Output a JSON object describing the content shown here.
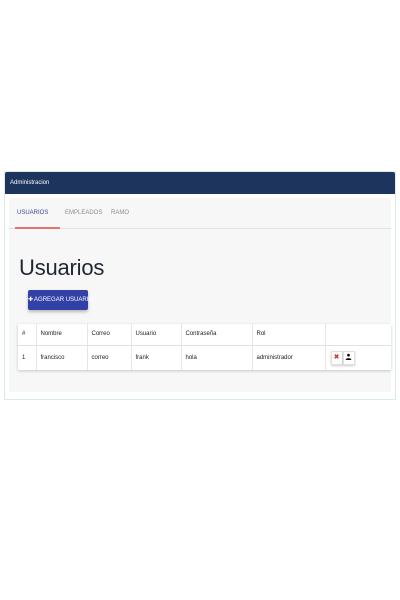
{
  "header": {
    "title": "Administracion"
  },
  "tabs": [
    {
      "label": "USUARIOS",
      "active": true
    },
    {
      "label": "EMPLEADOS",
      "active": false
    },
    {
      "label": "RAMO",
      "active": false
    }
  ],
  "main": {
    "title": "Usuarios",
    "add_button_label": "AGREGAR USUARIO"
  },
  "table": {
    "headers": [
      "#",
      "Nombre",
      "Correo",
      "Usuario",
      "Contraseña",
      "Rol",
      ""
    ],
    "rows": [
      {
        "id": "1",
        "nombre": "francisco",
        "correo": "correo",
        "usuario": "frank",
        "contrasena": "hola",
        "rol": "administrador"
      }
    ]
  },
  "icons": {
    "add": "plus-icon",
    "delete": "delete-icon",
    "user": "user-icon"
  },
  "colors": {
    "header_bg": "#1d355c",
    "active_tab_text": "#38479b",
    "active_tab_underline": "#e57373",
    "add_button_bg": "#3341a6",
    "delete_icon": "#d32f2f"
  }
}
